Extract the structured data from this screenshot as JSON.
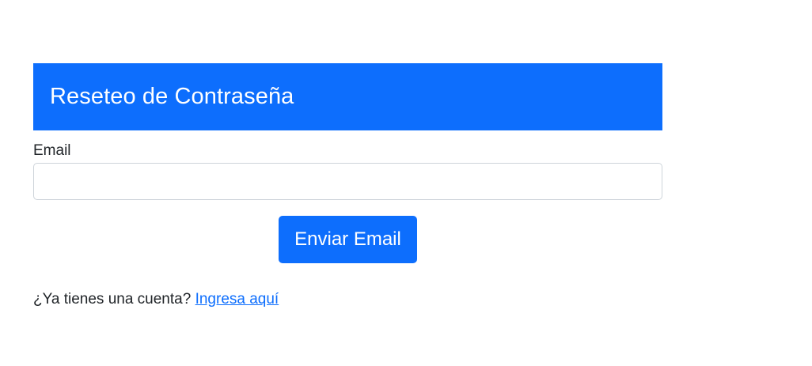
{
  "header": {
    "title": "Reseteo de Contraseña"
  },
  "form": {
    "email_label": "Email",
    "email_value": "",
    "email_placeholder": "",
    "submit_label": "Enviar Email"
  },
  "footer": {
    "prompt_text": "¿Ya tienes una cuenta?",
    "login_link_text": "Ingresa aquí"
  },
  "colors": {
    "primary": "#0d6efd",
    "text": "#212529",
    "input_border": "#ced4da"
  }
}
